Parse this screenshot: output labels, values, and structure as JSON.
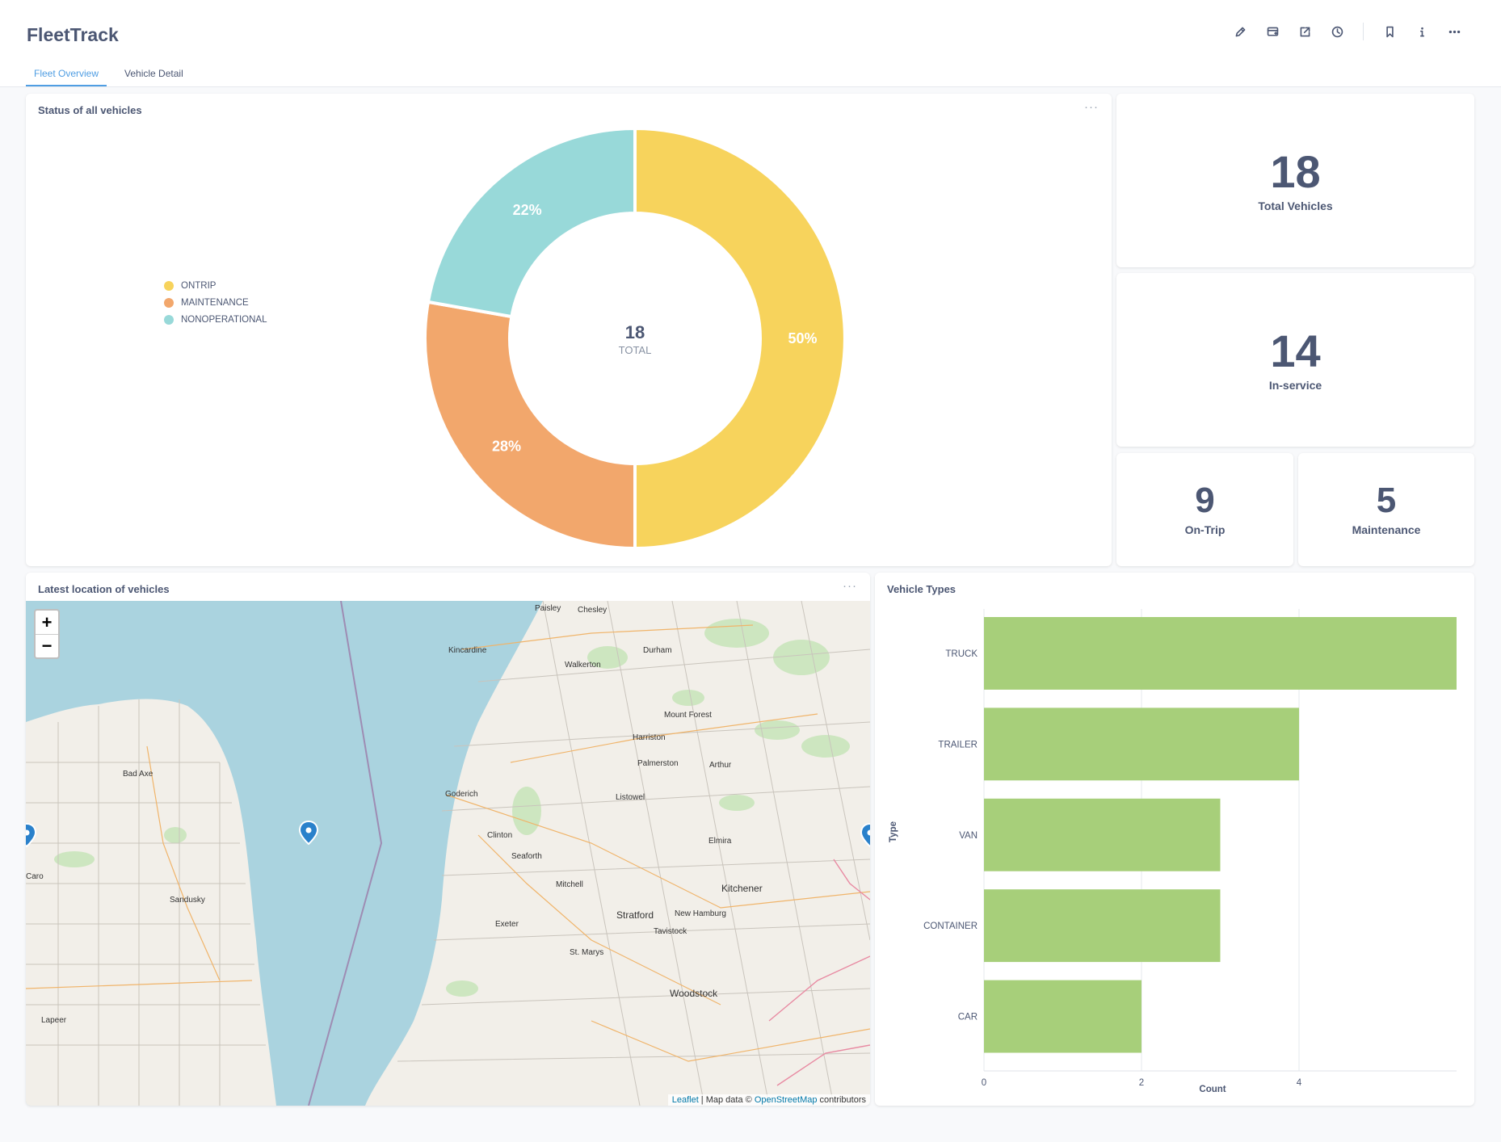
{
  "app": {
    "title": "FleetTrack"
  },
  "header": {
    "actions": [
      "edit-icon",
      "subscribe-icon",
      "share-icon",
      "history-icon",
      "bookmark-icon",
      "info-icon",
      "more-icon"
    ],
    "tabs": [
      {
        "label": "Fleet Overview",
        "active": true
      },
      {
        "label": "Vehicle Detail",
        "active": false
      }
    ]
  },
  "status_card": {
    "title": "Status of all vehicles",
    "menu": "···",
    "total_value": "18",
    "total_label": "TOTAL",
    "legend": [
      {
        "label": "ONTRIP",
        "color": "#f7d35c"
      },
      {
        "label": "MAINTENANCE",
        "color": "#f2a76c"
      },
      {
        "label": "NONOPERATIONAL",
        "color": "#98d9d9"
      }
    ],
    "slice_labels": [
      "50%",
      "28%",
      "22%"
    ]
  },
  "kpis": {
    "total": {
      "value": "18",
      "label": "Total Vehicles"
    },
    "in_service": {
      "value": "14",
      "label": "In-service"
    },
    "on_trip": {
      "value": "9",
      "label": "On-Trip"
    },
    "maintenance": {
      "value": "5",
      "label": "Maintenance"
    }
  },
  "map_card": {
    "title": "Latest location of vehicles",
    "menu": "···",
    "zoom_in": "+",
    "zoom_out": "−",
    "attribution": {
      "leaflet": "Leaflet",
      "map_data": " | Map data © ",
      "osm": "OpenStreetMap",
      "contributors": " contributors"
    },
    "places": [
      "Paisley",
      "Chesley",
      "Kincardine",
      "Durham",
      "Walkerton",
      "Mount Forest",
      "Harriston",
      "Palmerston",
      "Arthur",
      "Bad Axe",
      "Goderich",
      "Listowel",
      "Clinton",
      "Seaforth",
      "Elmira",
      "Mitchell",
      "Kitchener",
      "Caro",
      "Sandusky",
      "Stratford",
      "New Hamburg",
      "Exeter",
      "Tavistock",
      "St. Marys",
      "Woodstock",
      "Lapeer"
    ]
  },
  "types_card": {
    "title": "Vehicle Types",
    "x_ticks": [
      "0",
      "2",
      "4"
    ],
    "x_title": "Count",
    "y_title": "Type"
  },
  "chart_data": [
    {
      "type": "pie",
      "title": "Status of all vehicles",
      "categories": [
        "ONTRIP",
        "MAINTENANCE",
        "NONOPERATIONAL"
      ],
      "values": [
        9,
        5,
        4
      ],
      "percent_labels": [
        "50%",
        "28%",
        "22%"
      ],
      "total": 18,
      "legend": "left"
    },
    {
      "type": "bar",
      "orientation": "horizontal",
      "title": "Vehicle Types",
      "categories": [
        "TRUCK",
        "TRAILER",
        "VAN",
        "CONTAINER",
        "CAR"
      ],
      "values": [
        6,
        4,
        3,
        3,
        2
      ],
      "xlabel": "Count",
      "ylabel": "Type",
      "xlim": [
        0,
        6
      ],
      "xticks": [
        0,
        2,
        4
      ],
      "color": "#a7cf7a",
      "grid": true
    }
  ]
}
